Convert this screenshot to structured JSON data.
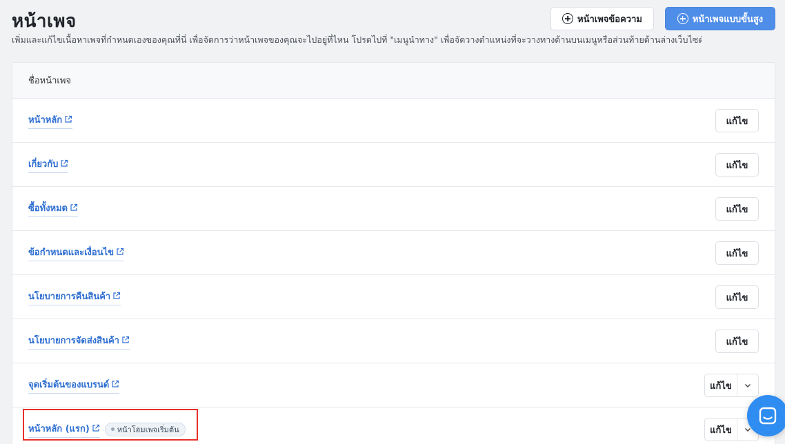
{
  "header": {
    "title": "หน้าเพจ",
    "description": "เพิ่มและแก้ไขเนื้อหาเพจที่กำหนดเองของคุณที่นี่ เพื่อจัดการว่าหน้าเพจของคุณจะไปอยู่ที่ไหน โปรดไปที่ \"เมนูนำทาง\" เพื่อจัดวางตำแหน่งที่จะวางทางด้านบนเมนูหรือส่วนท้ายด้านล่างเว็บไซต์",
    "text_page_button": "หน้าเพจข้อความ",
    "advanced_page_button": "หน้าเพจแบบขั้นสูง"
  },
  "table": {
    "column_header": "ชื่อหน้าเพจ",
    "edit_label": "แก้ไข",
    "rows": [
      {
        "name": "หน้าหลัก"
      },
      {
        "name": "เกี่ยวกับ"
      },
      {
        "name": "ซื้อทั้งหมด"
      },
      {
        "name": "ข้อกำหนดและเงื่อนไข"
      },
      {
        "name": "นโยบายการคืนสินค้า"
      },
      {
        "name": "นโยบายการจัดส่งสินค้า"
      },
      {
        "name": "จุดเริ่มต้นของแบรนด์"
      },
      {
        "name": "หน้าหลัก (แรก)",
        "badge": "หน้าโฮมเพจเริ่มต้น"
      }
    ]
  },
  "icons": {
    "plus": "plus-circle-icon",
    "external": "external-link-icon",
    "caret": "chevron-down-icon",
    "chat": "chat-icon"
  },
  "colors": {
    "accent": "#4f8ee8",
    "link": "#2f6fd1",
    "highlight": "#e8302a",
    "chat": "#2f8cf0"
  }
}
